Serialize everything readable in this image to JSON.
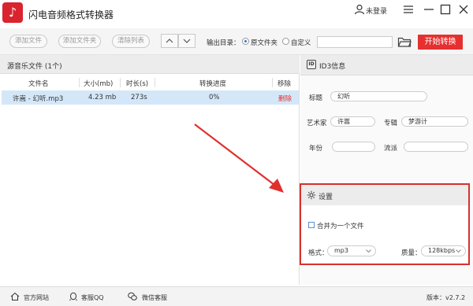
{
  "app": {
    "title": "闪电音频格式转换器",
    "logo_char": "♪",
    "login": "未登录"
  },
  "toolbar": {
    "add_file": "添加文件",
    "add_folder": "添加文件夹",
    "clear_list": "清除列表",
    "output_label": "输出目录：",
    "opt_original": "原文件夹",
    "opt_custom": "自定义",
    "path_value": "",
    "start": "开始转换"
  },
  "source": {
    "title": "源音乐文件 (1个)",
    "columns": [
      "文件名",
      "大小(mb)",
      "时长(s)",
      "转换进度",
      "移除"
    ],
    "rows": [
      {
        "name": "许嵩 - 幻听.mp3",
        "size": "4.23 mb",
        "duration": "273s",
        "progress": "0%",
        "remove": "删除"
      }
    ]
  },
  "id3": {
    "title": "ID3信息",
    "badge": "ID",
    "title_label": "标题",
    "title_value": "幻听",
    "artist_label": "艺术家",
    "artist_value": "许嵩",
    "album_label": "专辑",
    "album_value": "梦游计",
    "year_label": "年份",
    "year_value": "",
    "genre_label": "流派",
    "genre_value": ""
  },
  "settings": {
    "title": "设置",
    "merge_label": "合并为一个文件",
    "format_label": "格式：",
    "format_value": "mp3",
    "quality_label": "质量：",
    "quality_value": "128kbps"
  },
  "footer": {
    "website": "官方网站",
    "qq": "客服QQ",
    "wechat": "微信客服",
    "version": "版本：v2.7.2"
  },
  "colors": {
    "accent": "#e5302f",
    "selected_row": "#d4e7f8",
    "highlight_border": "#d8302c"
  }
}
